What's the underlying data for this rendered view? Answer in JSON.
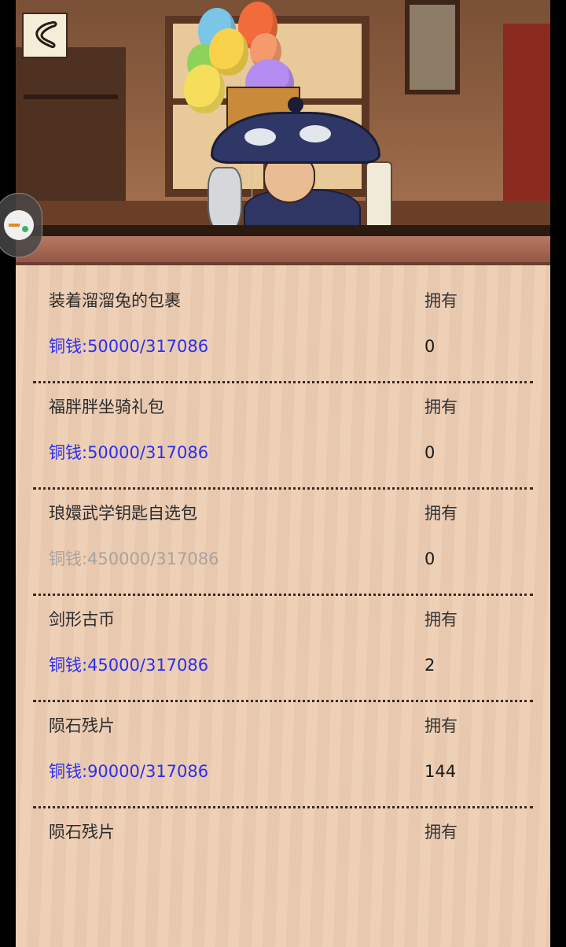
{
  "header": {
    "back_icon": "back-arrow-icon",
    "floating_icon": "gamepad-icon"
  },
  "items": [
    {
      "name": "装着溜溜兔的包裹",
      "own_label": "拥有",
      "cost": "铜钱:50000/317086",
      "owned": "0",
      "affordable": true
    },
    {
      "name": "福胖胖坐骑礼包",
      "own_label": "拥有",
      "cost": "铜钱:50000/317086",
      "owned": "0",
      "affordable": true
    },
    {
      "name": "琅嬛武学钥匙自选包",
      "own_label": "拥有",
      "cost": "铜钱:450000/317086",
      "owned": "0",
      "affordable": false
    },
    {
      "name": "剑形古币",
      "own_label": "拥有",
      "cost": "铜钱:45000/317086",
      "owned": "2",
      "affordable": true
    },
    {
      "name": "陨石残片",
      "own_label": "拥有",
      "cost": "铜钱:90000/317086",
      "owned": "144",
      "affordable": true
    },
    {
      "name": "陨石残片",
      "own_label": "拥有",
      "cost": "",
      "owned": "",
      "affordable": true
    }
  ],
  "colors": {
    "affordable": "#2a2ff0",
    "unaffordable": "#a8a3a0",
    "panel": "#edcdb3"
  }
}
